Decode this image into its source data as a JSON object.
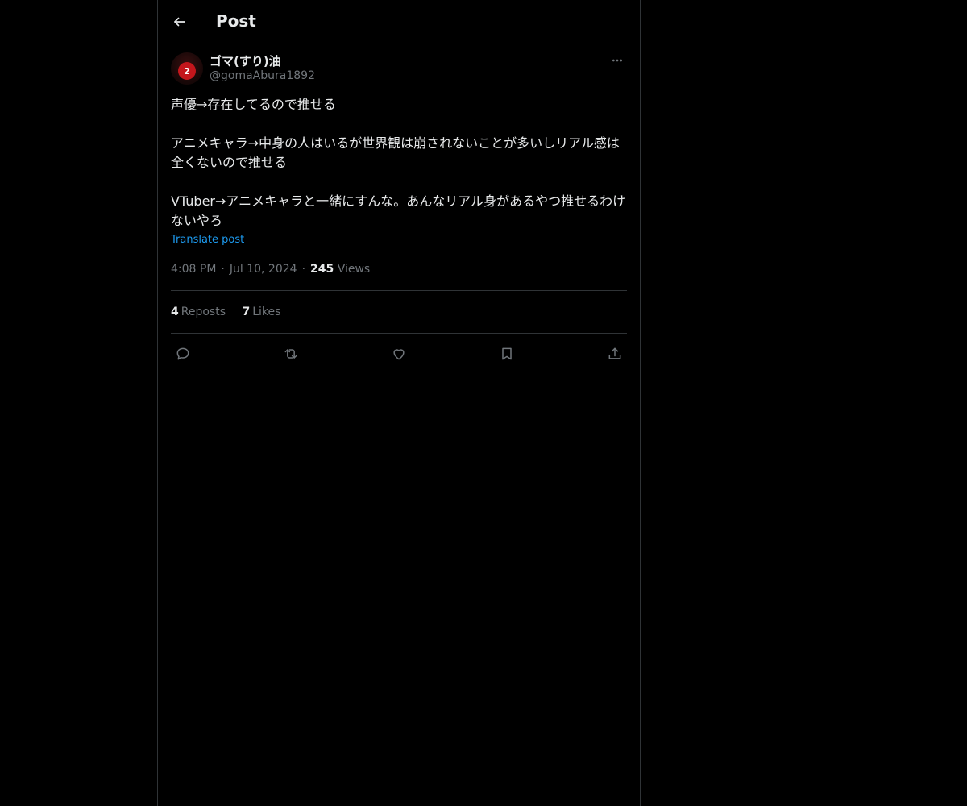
{
  "header": {
    "title": "Post",
    "back_icon": "arrow-left-icon"
  },
  "author": {
    "name": "ゴマ(すり)油",
    "handle": "@gomaAbura1892",
    "avatar_badge": "2"
  },
  "post": {
    "paragraphs": [
      "声優→存在してるので推せる",
      "アニメキャラ→中身の人はいるが世界観は崩されないことが多いしリアル感は全くないので推せる",
      "VTuber→アニメキャラと一緒にすんな。あんなリアル身があるやつ推せるわけないやろ"
    ],
    "translate_label": "Translate post",
    "time": "4:08 PM",
    "date": "Jul 10, 2024",
    "separator": "·",
    "views_count": "245",
    "views_label": "Views"
  },
  "stats": {
    "reposts_count": "4",
    "reposts_label": "Reposts",
    "likes_count": "7",
    "likes_label": "Likes"
  },
  "actions": [
    "reply-icon",
    "repost-icon",
    "like-icon",
    "bookmark-icon",
    "share-icon"
  ],
  "colors": {
    "background": "#000000",
    "text": "#e7e9ea",
    "muted": "#71767b",
    "link": "#1d9bf0",
    "border": "#2f3336"
  }
}
